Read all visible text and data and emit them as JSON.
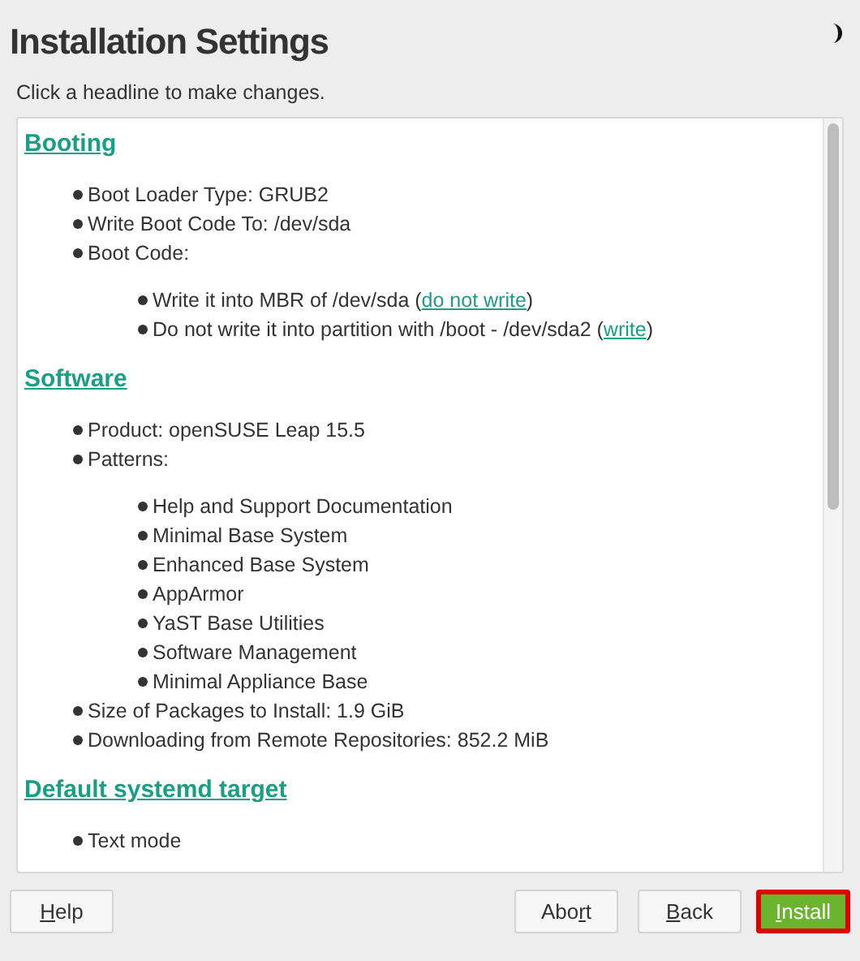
{
  "title": "Installation Settings",
  "hint": "Click a headline to make changes.",
  "sections": [
    {
      "heading": "Booting",
      "items": [
        {
          "text": "Boot Loader Type: GRUB2"
        },
        {
          "text": "Write Boot Code To: /dev/sda"
        },
        {
          "text": "Boot Code:",
          "children": [
            {
              "text": "Write it into MBR of /dev/sda (",
              "link": "do not write",
              "after": ")"
            },
            {
              "text": "Do not write it into partition with /boot - /dev/sda2 (",
              "link": "write",
              "after": ")"
            }
          ]
        }
      ]
    },
    {
      "heading": "Software",
      "items": [
        {
          "text": "Product: openSUSE Leap 15.5"
        },
        {
          "text": "Patterns:",
          "children": [
            {
              "text": "Help and Support Documentation"
            },
            {
              "text": "Minimal Base System"
            },
            {
              "text": "Enhanced Base System"
            },
            {
              "text": "AppArmor"
            },
            {
              "text": "YaST Base Utilities"
            },
            {
              "text": "Software Management"
            },
            {
              "text": "Minimal Appliance Base"
            }
          ]
        },
        {
          "text": "Size of Packages to Install: 1.9 GiB"
        },
        {
          "text": "Downloading from Remote Repositories: 852.2 MiB"
        }
      ]
    },
    {
      "heading": "Default systemd target",
      "items": [
        {
          "text": "Text mode"
        }
      ]
    }
  ],
  "buttons": [
    {
      "kind": "plain",
      "parts": [
        {
          "text": "H",
          "underlined": true
        },
        {
          "text": "elp"
        }
      ]
    },
    {
      "kind": "plain",
      "parts": [
        {
          "text": "Abo"
        },
        {
          "text": "r",
          "underlined": true
        },
        {
          "text": "t"
        }
      ]
    },
    {
      "kind": "plain",
      "parts": [
        {
          "text": "B",
          "underlined": true
        },
        {
          "text": "ack"
        }
      ]
    },
    {
      "kind": "primary",
      "focused": true,
      "parts": [
        {
          "text": "I",
          "underlined": true
        },
        {
          "text": "nstall"
        }
      ]
    }
  ]
}
